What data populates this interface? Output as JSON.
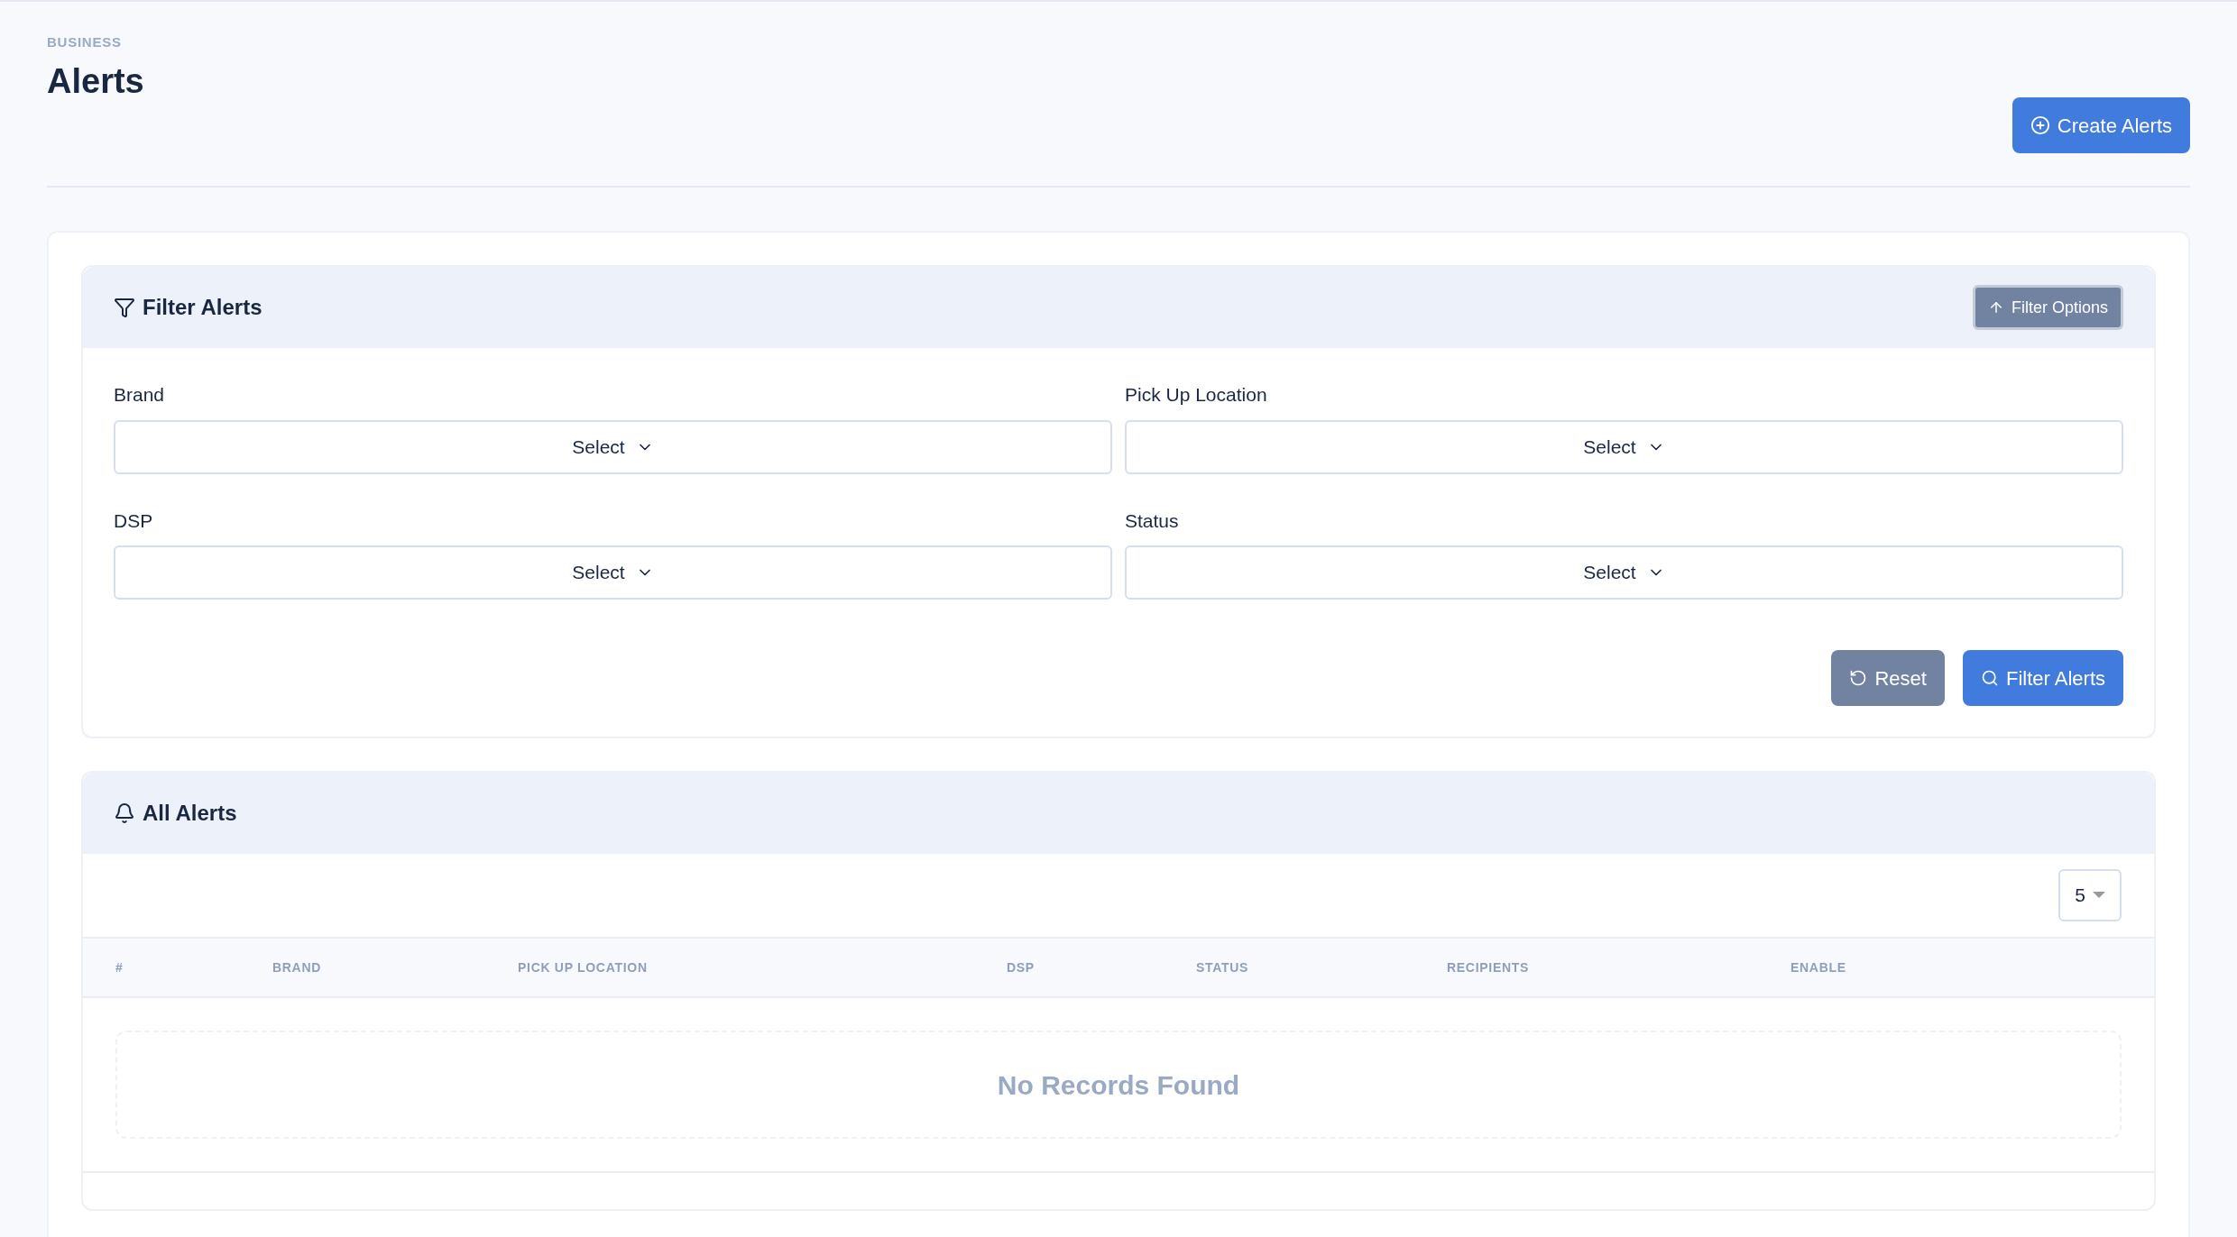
{
  "breadcrumb": "BUSINESS",
  "title": "Alerts",
  "create_button": {
    "label": "Create Alerts"
  },
  "filter_panel": {
    "title": "Filter Alerts",
    "options_button": "Filter Options",
    "fields": [
      {
        "label": "Brand",
        "value": "Select"
      },
      {
        "label": "Pick Up Location",
        "value": "Select"
      },
      {
        "label": "DSP",
        "value": "Select"
      },
      {
        "label": "Status",
        "value": "Select"
      }
    ],
    "reset_button": "Reset",
    "submit_button": "Filter Alerts"
  },
  "alerts_panel": {
    "title": "All Alerts",
    "page_size": "5",
    "table": {
      "columns": [
        "#",
        "BRAND",
        "PICK UP LOCATION",
        "DSP",
        "STATUS",
        "RECIPIENTS",
        "ENABLE"
      ],
      "empty_message": "No Records Found"
    }
  }
}
